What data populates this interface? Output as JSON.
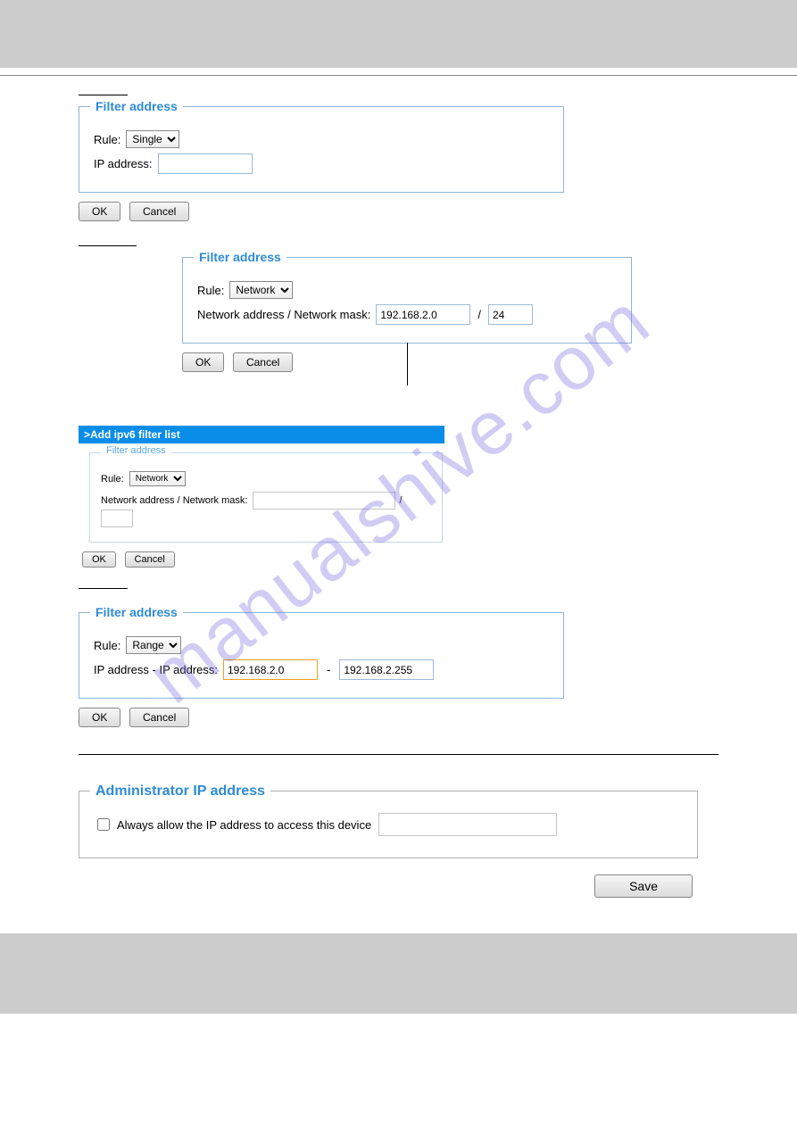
{
  "watermark": "manualshive.com",
  "panel1": {
    "title": "Filter address",
    "ruleLabel": "Rule:",
    "ruleValue": "Single",
    "ipLabel": "IP address:",
    "ipValue": "",
    "ok": "OK",
    "cancel": "Cancel"
  },
  "panel2": {
    "title": "Filter address",
    "ruleLabel": "Rule:",
    "ruleValue": "Network",
    "netLabel": "Network address / Network mask:",
    "netAddr": "192.168.2.0",
    "sep": "/",
    "mask": "24",
    "ok": "OK",
    "cancel": "Cancel"
  },
  "panel3": {
    "bar": ">Add ipv6 filter list",
    "title": "Filter address",
    "ruleLabel": "Rule:",
    "ruleValue": "Network",
    "netLabel": "Network address / Network mask:",
    "netAddr": "",
    "sep": "/",
    "mask": "",
    "ok": "OK",
    "cancel": "Cancel"
  },
  "panel4": {
    "title": "Filter address",
    "ruleLabel": "Rule:",
    "ruleValue": "Range",
    "rangeLabel": "IP address - IP address:",
    "from": "192.168.2.0",
    "dash": "-",
    "to": "192.168.2.255",
    "ok": "OK",
    "cancel": "Cancel"
  },
  "admin": {
    "title": "Administrator IP address",
    "chkLabel": "Always allow the IP address to access this device",
    "value": "",
    "save": "Save"
  }
}
